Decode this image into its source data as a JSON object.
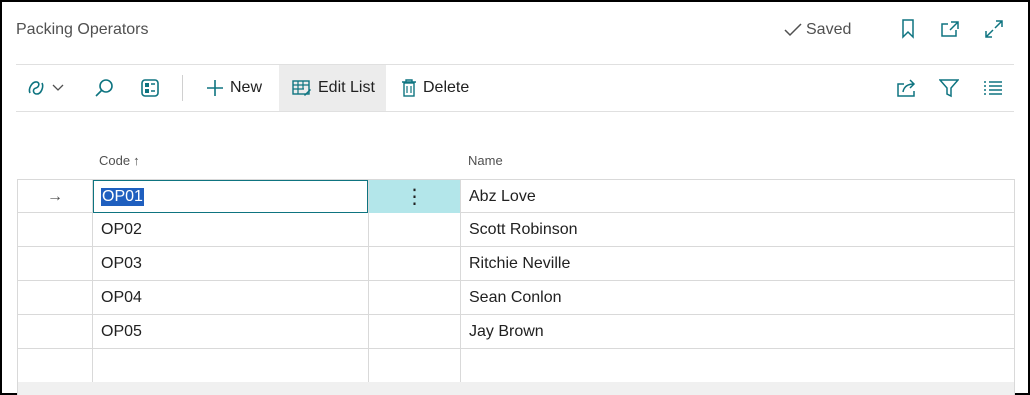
{
  "page": {
    "title": "Packing Operators",
    "saved_status": "Saved"
  },
  "header_icons": [
    "bookmark-icon",
    "open-new-window-icon",
    "expand-icon"
  ],
  "toolbar": {
    "new_label": "New",
    "edit_list_label": "Edit List",
    "delete_label": "Delete"
  },
  "columns": {
    "code": "Code",
    "code_sort": "↑",
    "name": "Name"
  },
  "rows": [
    {
      "code": "OP01",
      "name": "Abz Love"
    },
    {
      "code": "OP02",
      "name": "Scott Robinson"
    },
    {
      "code": "OP03",
      "name": "Ritchie Neville"
    },
    {
      "code": "OP04",
      "name": "Sean Conlon"
    },
    {
      "code": "OP05",
      "name": "Jay Brown"
    },
    {
      "code": "",
      "name": ""
    }
  ],
  "row_indicator": "→",
  "row_menu_glyph": "⋮",
  "colors": {
    "accent": "#0e7480",
    "selection_highlight": "#b3e6ea",
    "text_selection": "#1f5fbf"
  }
}
